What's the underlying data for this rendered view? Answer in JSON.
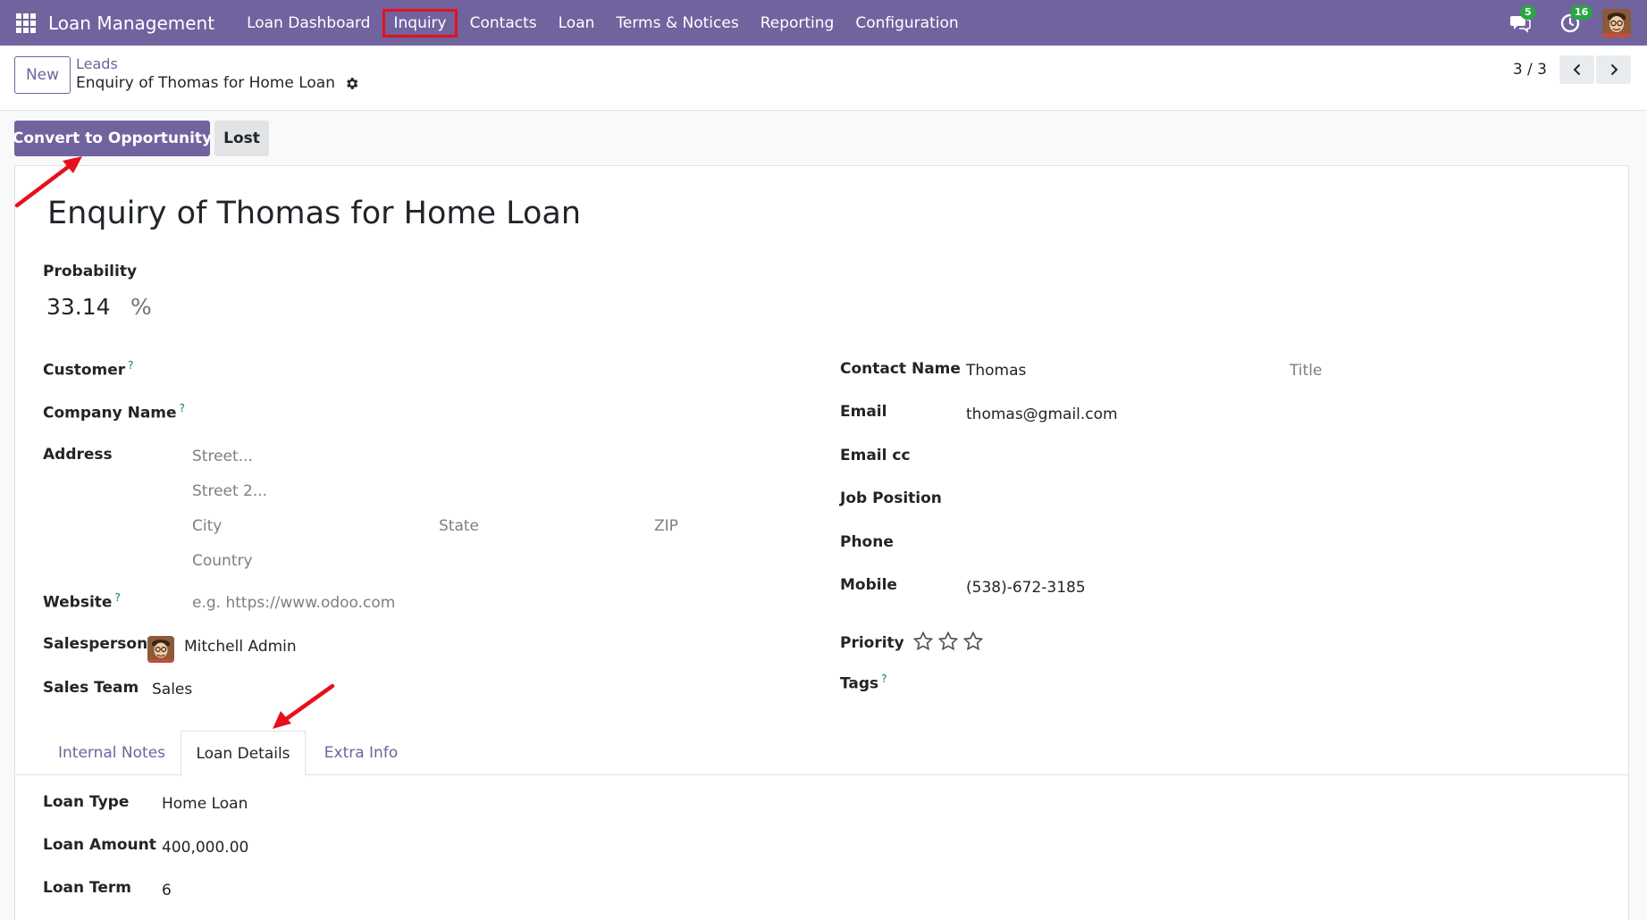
{
  "navbar": {
    "app_name": "Loan Management",
    "menu": [
      "Loan Dashboard",
      "Inquiry",
      "Contacts",
      "Loan",
      "Terms & Notices",
      "Reporting",
      "Configuration"
    ],
    "messages_count": "5",
    "activities_count": "16"
  },
  "control_panel": {
    "new_label": "New",
    "breadcrumb_parent": "Leads",
    "breadcrumb_current": "Enquiry of Thomas for Home Loan",
    "pager": "3 / 3"
  },
  "status_buttons": {
    "convert": "Convert to Opportunity",
    "lost": "Lost"
  },
  "form": {
    "title": "Enquiry of Thomas for Home Loan",
    "probability_label": "Probability",
    "probability_value": "33.14",
    "probability_unit": "%",
    "left": {
      "customer_label": "Customer",
      "company_label": "Company Name",
      "address_label": "Address",
      "street_placeholder": "Street...",
      "street2_placeholder": "Street 2...",
      "city_placeholder": "City",
      "state_placeholder": "State",
      "zip_placeholder": "ZIP",
      "country_placeholder": "Country",
      "website_label": "Website",
      "website_placeholder": "e.g. https://www.odoo.com",
      "salesperson_label": "Salesperson",
      "salesperson_value": "Mitchell Admin",
      "sales_team_label": "Sales Team",
      "sales_team_value": "Sales"
    },
    "right": {
      "contact_name_label": "Contact Name",
      "contact_name_value": "Thomas",
      "title_placeholder": "Title",
      "email_label": "Email",
      "email_value": "thomas@gmail.com",
      "email_cc_label": "Email cc",
      "job_position_label": "Job Position",
      "phone_label": "Phone",
      "mobile_label": "Mobile",
      "mobile_value": "(538)-672-3185",
      "priority_label": "Priority",
      "priority_stars": 0,
      "priority_max": 3,
      "tags_label": "Tags"
    },
    "help_mark": "?",
    "tabs": [
      "Internal Notes",
      "Loan Details",
      "Extra Info"
    ],
    "active_tab": "Loan Details",
    "loan_details": {
      "loan_type_label": "Loan Type",
      "loan_type_value": "Home Loan",
      "loan_amount_label": "Loan Amount",
      "loan_amount_value": "400,000.00",
      "loan_term_label": "Loan Term",
      "loan_term_value": "6"
    }
  },
  "colors": {
    "brand": "#71639e",
    "annotation_red": "#e5101c",
    "badge_green": "#28a745",
    "help_teal": "#017e84"
  }
}
